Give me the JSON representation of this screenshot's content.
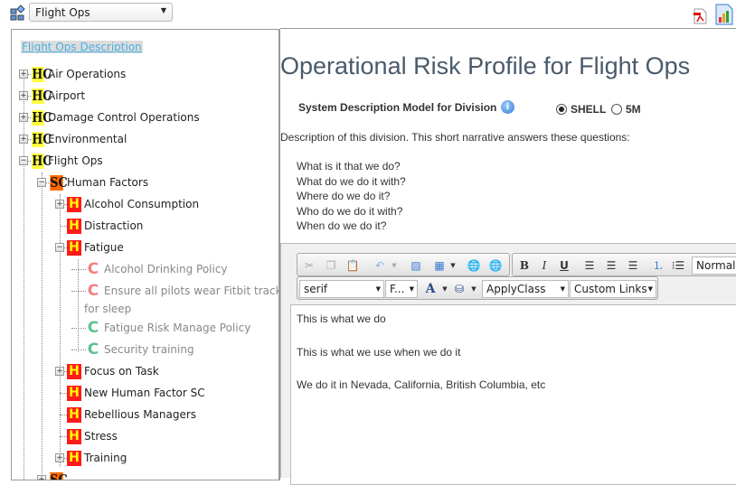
{
  "header": {
    "division_select": "Flight Ops",
    "icons": [
      "hierarchy-icon",
      "pdf-export-icon",
      "report-icon"
    ]
  },
  "tree": {
    "description_link": "Flight Ops Description",
    "rows": [
      {
        "level": 0,
        "expander": "plus",
        "icon": "HC",
        "label": "Air Operations"
      },
      {
        "level": 0,
        "expander": "plus",
        "icon": "HC",
        "label": "Airport"
      },
      {
        "level": 0,
        "expander": "plus",
        "icon": "HC",
        "label": "Damage Control Operations"
      },
      {
        "level": 0,
        "expander": "plus",
        "icon": "HC",
        "label": "Environmental"
      },
      {
        "level": 0,
        "expander": "minus",
        "icon": "HC",
        "label": "Flight Ops"
      },
      {
        "level": 1,
        "expander": "minus",
        "icon": "SC",
        "label": "Human Factors"
      },
      {
        "level": 2,
        "expander": "plus",
        "icon": "H",
        "label": "Alcohol Consumption"
      },
      {
        "level": 2,
        "expander": "none",
        "icon": "H",
        "label": "Distraction"
      },
      {
        "level": 2,
        "expander": "minus",
        "icon": "H",
        "label": "Fatigue"
      },
      {
        "level": 3,
        "expander": "none",
        "icon": "C",
        "icon_color": "#f08080",
        "label": "Alcohol Drinking Policy"
      },
      {
        "level": 3,
        "expander": "none",
        "icon": "C",
        "icon_color": "#f08080",
        "label": "Ensure all pilots wear Fitbit trackers",
        "label2": "for sleep"
      },
      {
        "level": 3,
        "expander": "none",
        "icon": "C",
        "icon_color": "#60c090",
        "label": "Fatigue Risk Manage Policy"
      },
      {
        "level": 3,
        "expander": "none",
        "icon": "C",
        "icon_color": "#60c090",
        "label": "Security training"
      },
      {
        "level": 2,
        "expander": "plus",
        "icon": "H",
        "label": "Focus on Task"
      },
      {
        "level": 2,
        "expander": "none",
        "icon": "H",
        "label": "New Human Factor SC"
      },
      {
        "level": 2,
        "expander": "none",
        "icon": "H",
        "label": "Rebellious Managers"
      },
      {
        "level": 2,
        "expander": "none",
        "icon": "H",
        "label": "Stress"
      },
      {
        "level": 2,
        "expander": "plus",
        "icon": "H",
        "label": "Training"
      },
      {
        "level": 1,
        "expander": "plus",
        "icon": "SC",
        "label": ""
      }
    ]
  },
  "main": {
    "title": "Operational Risk Profile for Flight Ops",
    "model_label": "System Description Model for Division",
    "model_options": [
      {
        "label": "SHELL",
        "selected": true
      },
      {
        "label": "5M",
        "selected": false
      }
    ],
    "description_intro": "Description of this division. This short narrative answers these questions:",
    "questions": [
      "What is it that we do?",
      "What do we do it with?",
      "Where do we do it?",
      "Who do we do it with?",
      "When do we do it?"
    ],
    "editor": {
      "format_select": "Normal",
      "font_select": "serif",
      "size_select": "F...",
      "apply_class": "ApplyClass",
      "custom_links": "Custom Links",
      "content": [
        "This is what we do",
        "This is what we use when we do it",
        "We do it in Nevada, California, British Columbia, etc"
      ]
    }
  }
}
